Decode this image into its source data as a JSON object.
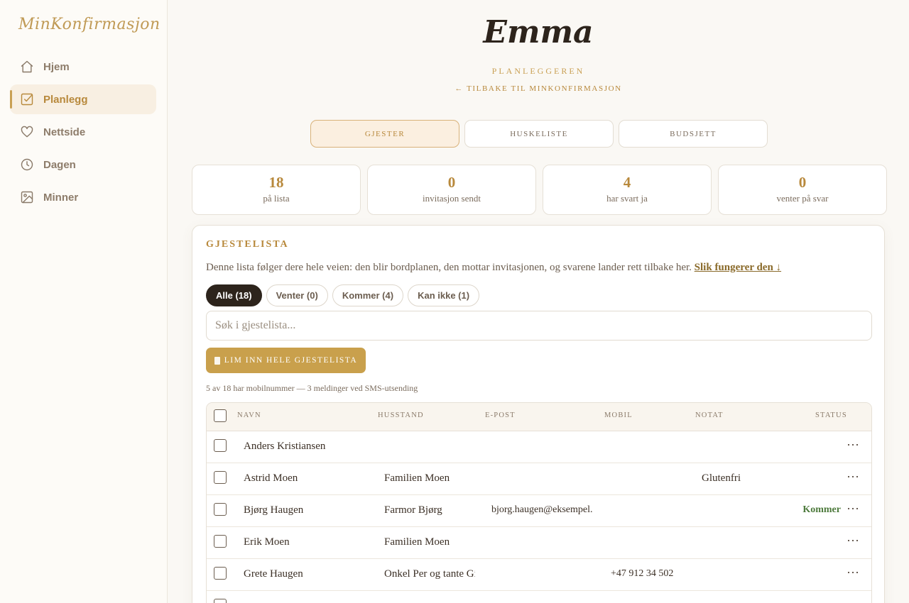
{
  "sidebar": {
    "brand": "MinKonfirmasjon",
    "items": [
      {
        "label": "Hjem",
        "icon": "home-icon"
      },
      {
        "label": "Planlegg",
        "icon": "checklist-icon",
        "active": true
      },
      {
        "label": "Nettside",
        "icon": "heart-icon"
      },
      {
        "label": "Dagen",
        "icon": "clock-icon"
      },
      {
        "label": "Minner",
        "icon": "image-icon"
      }
    ]
  },
  "header": {
    "title": "Emma",
    "subtitle": "PLANLEGGEREN",
    "back_link": "← TILBAKE TIL MINKONFIRMASJON"
  },
  "tabs": [
    {
      "label": "GJESTER",
      "active": true
    },
    {
      "label": "HUSKELISTE"
    },
    {
      "label": "BUDSJETT"
    }
  ],
  "stats": [
    {
      "value": "18",
      "label": "på lista"
    },
    {
      "value": "0",
      "label": "invitasjon sendt"
    },
    {
      "value": "4",
      "label": "har svart ja"
    },
    {
      "value": "0",
      "label": "venter på svar"
    }
  ],
  "guestlist": {
    "title": "GJESTELISTA",
    "description": "Denne lista følger dere hele veien: den blir bordplanen, den mottar invitasjonen, og svarene lander rett tilbake her.",
    "help_link": "Slik fungerer den ↓",
    "filters": [
      {
        "label": "Alle (18)",
        "active": true
      },
      {
        "label": "Venter (0)"
      },
      {
        "label": "Kommer (4)"
      },
      {
        "label": "Kan ikke (1)"
      }
    ],
    "search_placeholder": "Søk i gjestelista...",
    "paste_button": "LIM INN HELE GJESTELISTA",
    "sms_note": "5 av 18 har mobilnummer — 3 meldinger ved SMS-utsending",
    "columns": [
      "NAVN",
      "HUSSTAND",
      "E-POST",
      "MOBIL",
      "NOTAT",
      "STATUS"
    ],
    "rows": [
      {
        "name": "Anders Kristiansen",
        "household": "",
        "email": "",
        "mobile": "",
        "note": "",
        "status": "",
        "more": "⋯"
      },
      {
        "name": "Astrid Moen",
        "household": "Familien Moen",
        "email": "",
        "mobile": "",
        "note": "Glutenfri",
        "status": "",
        "more": "⋯"
      },
      {
        "name": "Bjørg Haugen",
        "household": "Farmor Bjørg",
        "email": "bjorg.haugen@eksempel.",
        "mobile": "",
        "note": "",
        "status": "Kommer",
        "more": "⋯"
      },
      {
        "name": "Erik Moen",
        "household": "Familien Moen",
        "email": "",
        "mobile": "",
        "note": "",
        "status": "",
        "more": "⋯"
      },
      {
        "name": "Grete Haugen",
        "household": "Onkel Per og tante Gi",
        "email": "",
        "mobile": "+47 912 34 502",
        "note": "",
        "status": "",
        "more": "⋯"
      },
      {
        "name": "",
        "household": "",
        "email": "",
        "mobile": "",
        "note": "",
        "status": "",
        "more": ""
      }
    ]
  }
}
